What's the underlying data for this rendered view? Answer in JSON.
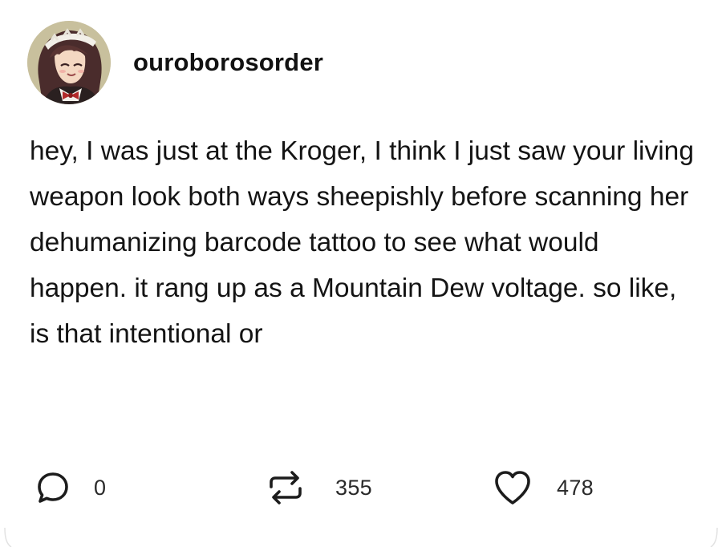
{
  "post": {
    "username": "ouroborosorder",
    "avatar_icon": "anime-character-avatar",
    "text": "hey, I was just at the Kroger, I think I just saw your living weapon look both ways sheepishly before scanning her dehumanizing barcode tattoo to see what would happen. it rang up as a Mountain Dew voltage. so like, is that intentional or"
  },
  "footer": {
    "replies": {
      "icon": "reply-bubble-icon",
      "count": "0"
    },
    "reblogs": {
      "icon": "reblog-icon",
      "count": "355"
    },
    "likes": {
      "icon": "heart-icon",
      "count": "478"
    }
  },
  "colors": {
    "background": "#ffffff",
    "text": "#141414",
    "icon": "#1c1c1c"
  }
}
